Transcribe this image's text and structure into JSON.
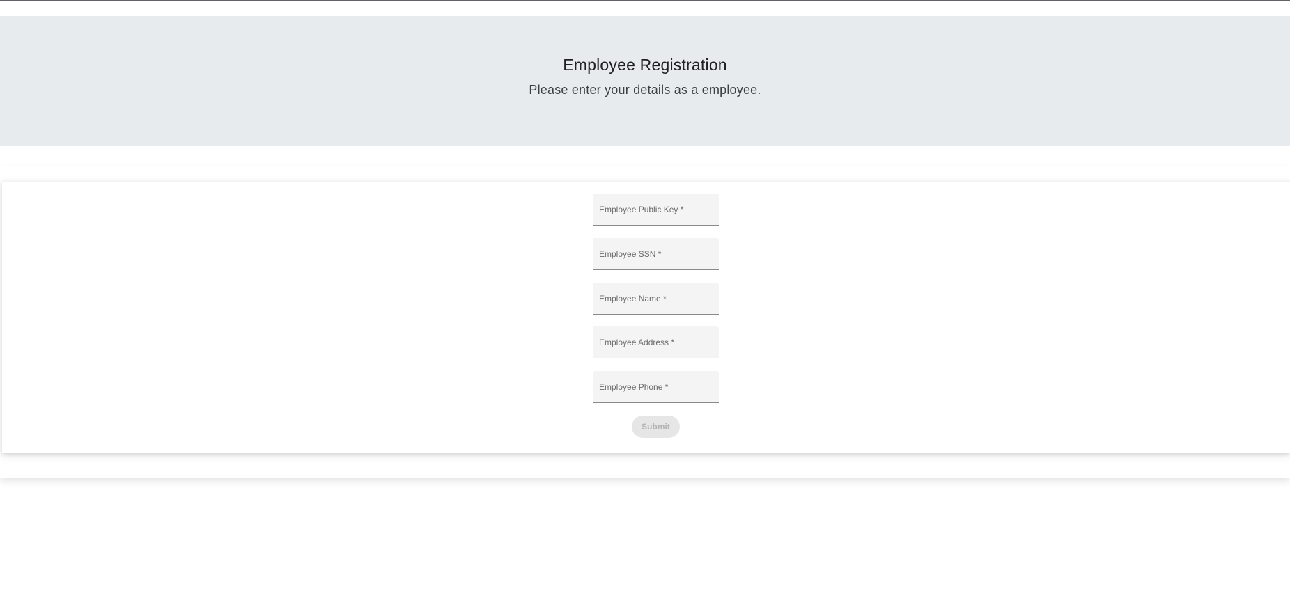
{
  "header": {
    "title": "Employee Registration",
    "subtitle": "Please enter your details as a employee."
  },
  "form": {
    "fields": [
      {
        "name": "public-key",
        "placeholder": "Employee Public Key *",
        "value": ""
      },
      {
        "name": "ssn",
        "placeholder": "Employee SSN *",
        "value": ""
      },
      {
        "name": "name",
        "placeholder": "Employee Name *",
        "value": ""
      },
      {
        "name": "address",
        "placeholder": "Employee Address *",
        "value": ""
      },
      {
        "name": "phone",
        "placeholder": "Employee Phone *",
        "value": ""
      }
    ],
    "submit_label": "Submit",
    "submit_disabled": true
  },
  "colors": {
    "header_background": "#e8ebee",
    "field_background": "#f4f4f4",
    "button_disabled_background": "#e6e6e6",
    "button_disabled_text": "#b3b3b3"
  }
}
